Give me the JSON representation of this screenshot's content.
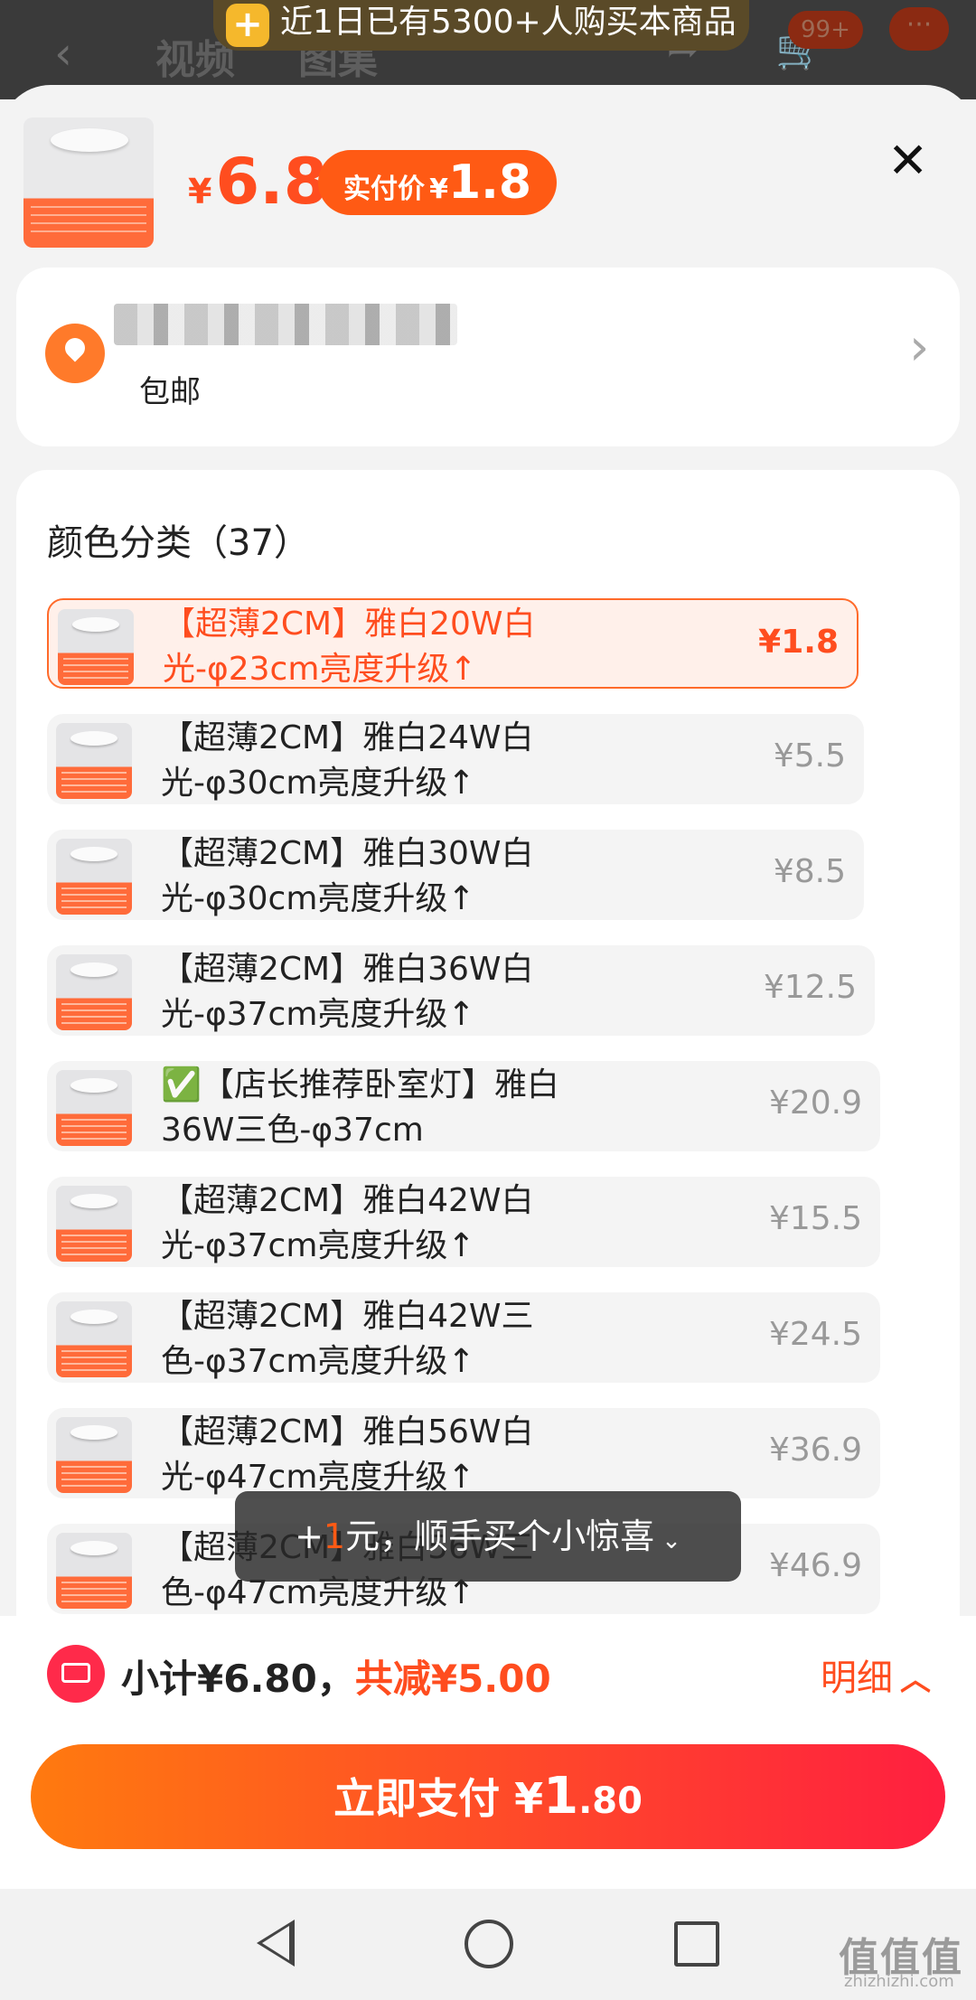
{
  "background": {
    "nav_tabs": [
      "视频",
      "图集"
    ],
    "badge": "99+",
    "more": "···",
    "promo": "近1日已有5300+人购买本商品"
  },
  "header": {
    "currency": "¥",
    "price": "6.8",
    "real_price_label": "实付价",
    "real_price_currency": "¥",
    "real_price": "1.8",
    "close": "✕"
  },
  "address": {
    "shipping": "包邮"
  },
  "options": {
    "title": "颜色分类（37）",
    "items": [
      {
        "label": "【超薄2CM】雅白20W白光-φ23cm亮度升级↑",
        "price": "¥1.8",
        "selected": true
      },
      {
        "label": "【超薄2CM】雅白24W白光-φ30cm亮度升级↑",
        "price": "¥5.5",
        "selected": false
      },
      {
        "label": "【超薄2CM】雅白30W白光-φ30cm亮度升级↑",
        "price": "¥8.5",
        "selected": false
      },
      {
        "label": "【超薄2CM】雅白36W白光-φ37cm亮度升级↑",
        "price": "¥12.5",
        "selected": false
      },
      {
        "label": "✅【店长推荐卧室灯】雅白36W三色-φ37cm",
        "price": "¥20.9",
        "selected": false
      },
      {
        "label": "【超薄2CM】雅白42W白光-φ37cm亮度升级↑",
        "price": "¥15.5",
        "selected": false
      },
      {
        "label": "【超薄2CM】雅白42W三色-φ37cm亮度升级↑",
        "price": "¥24.5",
        "selected": false
      },
      {
        "label": "【超薄2CM】雅白56W白光-φ47cm亮度升级↑",
        "price": "¥36.9",
        "selected": false
      },
      {
        "label": "【超薄2CM】雅白56W三色-φ47cm亮度升级↑",
        "price": "¥46.9",
        "selected": false
      }
    ]
  },
  "toast": {
    "prefix": "+",
    "amount": "1",
    "text": "元，顺手买个小惊喜",
    "chevron": "⌄"
  },
  "summary": {
    "subtotal": "小计¥6.80，",
    "discount": "共减¥5.00",
    "detail_label": "明细",
    "detail_icon": "︿"
  },
  "pay_button": {
    "label": "立即支付 ",
    "currency": "¥",
    "amount_int": "1",
    "amount_dec": ".80"
  },
  "watermark": {
    "text": "值值值",
    "url": "zhizhizhi.com"
  },
  "colors": {
    "accent": "#ff4d1f",
    "pay_gradient_start": "#ff7a0f",
    "pay_gradient_end": "#ff1f40"
  }
}
